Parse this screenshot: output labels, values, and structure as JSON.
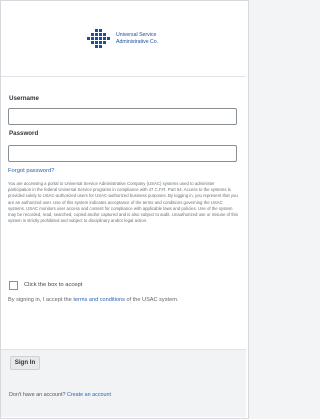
{
  "brand": {
    "line1": "Universal Service",
    "line2": "Administrative Co.",
    "logo_icon": "usac-dots-icon",
    "color": "#1b4f9c"
  },
  "form": {
    "username_label": "Username",
    "password_label": "Password",
    "forgot_password": "Forgot password?",
    "legal_text": "You are accessing a portal to Universal Service Administrative Company (USAC) systems used to administer participation in the federal Universal Service programs in compliance with 47 C.F.R. Part 54. Access to the systems is provided solely to USAC-authorized users for USAC-authorized business purposes. By logging in, you represent that you are an authorized user. Use of this system indicates acceptance of the terms and conditions governing the USAC systems. USAC monitors user access and content for compliance with applicable laws and policies. Use of the system may be recorded, read, searched, copied and/or captured and is also subject to audit. Unauthorized use or misuse of this system is strictly prohibited and subject to disciplinary and/or legal action.",
    "checkbox_label": "Click the box to accept",
    "terms_prefix": "By signing in, I accept the ",
    "terms_link": "terms and conditions",
    "terms_suffix": " of the USAC system."
  },
  "footer": {
    "signin_label": "Sign In",
    "account_prefix": "Don't have an account? ",
    "create_link": "Create an account"
  },
  "colors": {
    "link": "#2f63b0",
    "border": "#8a8f94"
  }
}
